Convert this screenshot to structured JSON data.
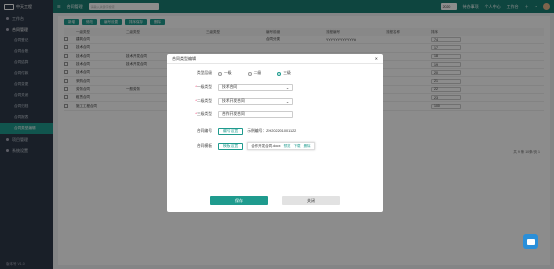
{
  "sidebar": {
    "logo": "中天工程",
    "groups": [
      {
        "label": "工作台",
        "active": false
      },
      {
        "label": "合同管理",
        "active": true
      }
    ],
    "items": [
      "合同登记",
      "合同台账",
      "合同结算",
      "合同付款",
      "合同变更",
      "合同关闭",
      "合同归档",
      "合同报表",
      "合同类型编辑"
    ],
    "active_index": 8,
    "groups_after": [
      "项目管理",
      "系统设置"
    ],
    "footer": "版本号 V1.0"
  },
  "topbar": {
    "title": "合同管理",
    "search_placeholder": "请输入关键字搜索",
    "year": "2020",
    "links": [
      "待办事项",
      "个人中心",
      "工作台"
    ]
  },
  "toolbar": [
    "新增",
    "修改",
    "编号设置",
    "排序保存",
    "删除"
  ],
  "table": {
    "headers": [
      "",
      "一级类型",
      "二级类型",
      "三级类型",
      "编号前缀",
      "流程编号",
      "流程名称",
      "排序"
    ],
    "rows": [
      {
        "c1": "建筑合同",
        "c2": "",
        "c3": "",
        "c4": "合同分类",
        "c5": "YYYYYYYYYYYY#",
        "c6": "",
        "c7": "74"
      },
      {
        "c1": "技术合同",
        "c2": "",
        "c3": "",
        "c4": "",
        "c5": "",
        "c6": "",
        "c7": "17"
      },
      {
        "c1": "技术合同",
        "c2": "技术开发合同",
        "c3": "",
        "c4": "",
        "c5": "",
        "c6": "",
        "c7": "18"
      },
      {
        "c1": "技术合同",
        "c2": "技术开发合同",
        "c3": "",
        "c4": "",
        "c5": "",
        "c6": "",
        "c7": "19"
      },
      {
        "c1": "技术合同",
        "c2": "",
        "c3": "",
        "c4": "",
        "c5": "",
        "c6": "",
        "c7": "20"
      },
      {
        "c1": "采购合同",
        "c2": "",
        "c3": "",
        "c4": "",
        "c5": "",
        "c6": "",
        "c7": "21"
      },
      {
        "c1": "劳务合同",
        "c2": "一般劳务",
        "c3": "",
        "c4": "",
        "c5": "",
        "c6": "",
        "c7": "22"
      },
      {
        "c1": "租赁合同",
        "c2": "",
        "c3": "",
        "c4": "",
        "c5": "",
        "c6": "",
        "c7": "23"
      },
      {
        "c1": "施工工程合同",
        "c2": "",
        "c3": "",
        "c4": "",
        "c5": "",
        "c6": "",
        "c7": "100"
      }
    ]
  },
  "pager": "共 9 条  10条/页  1",
  "modal": {
    "title": "合同类型编辑",
    "level_label": "类型层级",
    "levels": [
      "一级",
      "二级",
      "三级"
    ],
    "level_selected": 2,
    "type1_label": "一级类型",
    "type1_value": "技术合同",
    "type2_label": "二级类型",
    "type2_value": "技术开发合同",
    "type3_label": "三级类型",
    "type3_value": "合作开发合同",
    "code_label": "合同编号",
    "code_button": "编号设置",
    "code_preview": "示例编号：ZH202201001122",
    "template_label": "合同模板",
    "template_button": "模板设置",
    "template_file": "合作开发合同.docx",
    "template_actions": [
      "预览",
      "下载",
      "删除"
    ],
    "save": "保存",
    "close": "关闭"
  }
}
